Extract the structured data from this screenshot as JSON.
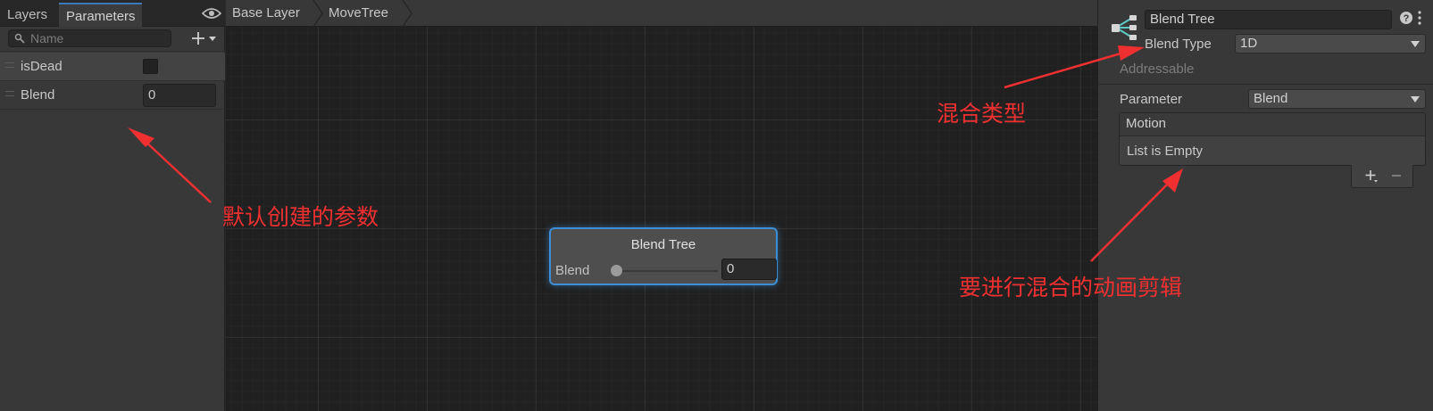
{
  "left_panel": {
    "tabs": [
      {
        "label": "Layers",
        "active": false
      },
      {
        "label": "Parameters",
        "active": true
      }
    ],
    "search": {
      "placeholder": "Name",
      "value": ""
    },
    "add_button_icon": "plus-dropdown-icon",
    "visibility_icon": "eye-icon",
    "parameters": [
      {
        "name": "isDead",
        "type": "bool",
        "value": false
      },
      {
        "name": "Blend",
        "type": "float",
        "value": "0"
      }
    ]
  },
  "graph": {
    "breadcrumb": [
      "Base Layer",
      "MoveTree"
    ],
    "node": {
      "title": "Blend Tree",
      "parameter_label": "Blend",
      "value": "0",
      "slider_position": 0
    }
  },
  "inspector": {
    "name": "Blend Tree",
    "blend_type_label": "Blend Type",
    "blend_type_value": "1D",
    "addressable_label": "Addressable",
    "parameter_label": "Parameter",
    "parameter_value": "Blend",
    "motion_header": "Motion",
    "motion_empty": "List is Empty",
    "icons": [
      "blend-tree-icon",
      "help-icon",
      "more-options-icon",
      "add-icon",
      "remove-icon"
    ]
  },
  "annotations": {
    "default_params": "默认创建的参数",
    "blend_type": "混合类型",
    "motion_clips": "要进行混合的动画剪辑"
  },
  "colors": {
    "annotation": "#f03030",
    "node_border": "#3d8ed6",
    "tree_icon": "#5ec9c4",
    "active_tab": "#3a79bb"
  }
}
